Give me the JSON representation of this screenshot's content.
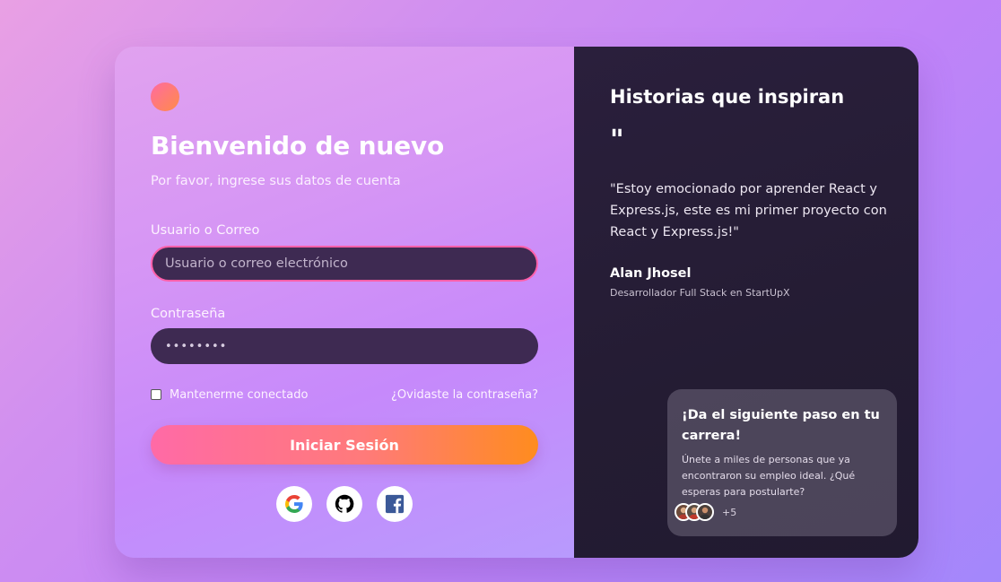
{
  "login": {
    "title": "Bienvenido de nuevo",
    "subtitle": "Por favor, ingrese sus datos de cuenta",
    "username_label": "Usuario o Correo",
    "username_placeholder": "Usuario o correo electrónico",
    "password_label": "Contraseña",
    "password_value": "••••••••",
    "remember_label": "Mantenerme conectado",
    "forgot_link": "¿Ovidaste la contraseña?",
    "submit_label": "Iniciar Sesión",
    "social": [
      "google-icon",
      "github-icon",
      "facebook-icon"
    ]
  },
  "testimonial": {
    "title": "Historias que inspiran",
    "quote_mark": "\"",
    "quote": "\"Estoy emocionado por aprender React y Express.js, este es mi primer proyecto con React y Express.js!\"",
    "author": "Alan Jhosel",
    "role": "Desarrollador Full Stack en StartUpX"
  },
  "cta": {
    "title": "¡Da el siguiente paso en tu carrera!",
    "text": "Únete a miles de personas que ya encontraron su empleo ideal. ¿Qué esperas para postularte?",
    "avatar_count": "+5"
  },
  "colors": {
    "accent_pink": "#ff6aa6",
    "accent_orange": "#ff8c1e",
    "input_bg": "#3e2a52",
    "panel_dark": "#241c33"
  }
}
